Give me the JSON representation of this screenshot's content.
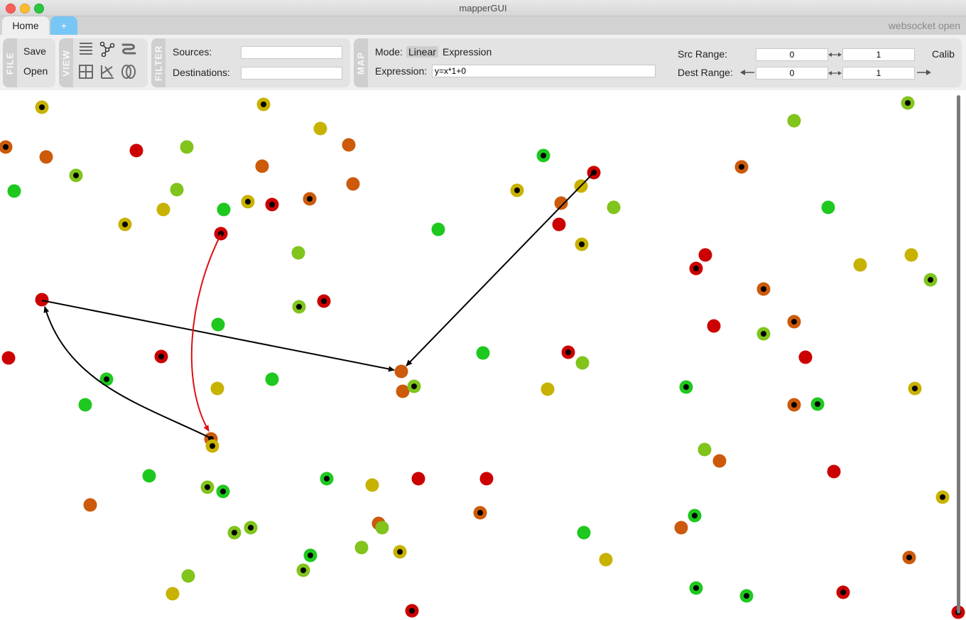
{
  "window": {
    "title": "mapperGUI"
  },
  "tabs": {
    "home": "Home",
    "add": "+"
  },
  "status": "websocket open",
  "file_panel": {
    "label": "FILE",
    "save": "Save",
    "open": "Open"
  },
  "view_panel": {
    "label": "VIEW",
    "icons": [
      "list-view-icon",
      "graph-view-icon",
      "canvas-view-icon",
      "grid-view-icon",
      "parallel-view-icon",
      "balloon-view-icon"
    ]
  },
  "filter_panel": {
    "label": "FILTER",
    "sources_label": "Sources:",
    "sources_value": "",
    "destinations_label": "Destinations:",
    "destinations_value": ""
  },
  "map_panel": {
    "label": "MAP",
    "mode_label": "Mode:",
    "mode_linear": "Linear",
    "mode_expression": "Expression",
    "expression_label": "Expression:",
    "expression_value": "y=x*1+0",
    "src_range_label": "Src Range:",
    "src_min": "0",
    "src_max": "1",
    "calib": "Calib",
    "dest_range_label": "Dest Range:",
    "dest_min": "0",
    "dest_max": "1"
  },
  "colors": {
    "red": "#cc0000",
    "orange": "#cc5a0a",
    "yellow": "#c8b200",
    "lime": "#80c41c",
    "green": "#1ec81e",
    "map_arrow": "#000000",
    "selected_map": "#e01010"
  }
}
